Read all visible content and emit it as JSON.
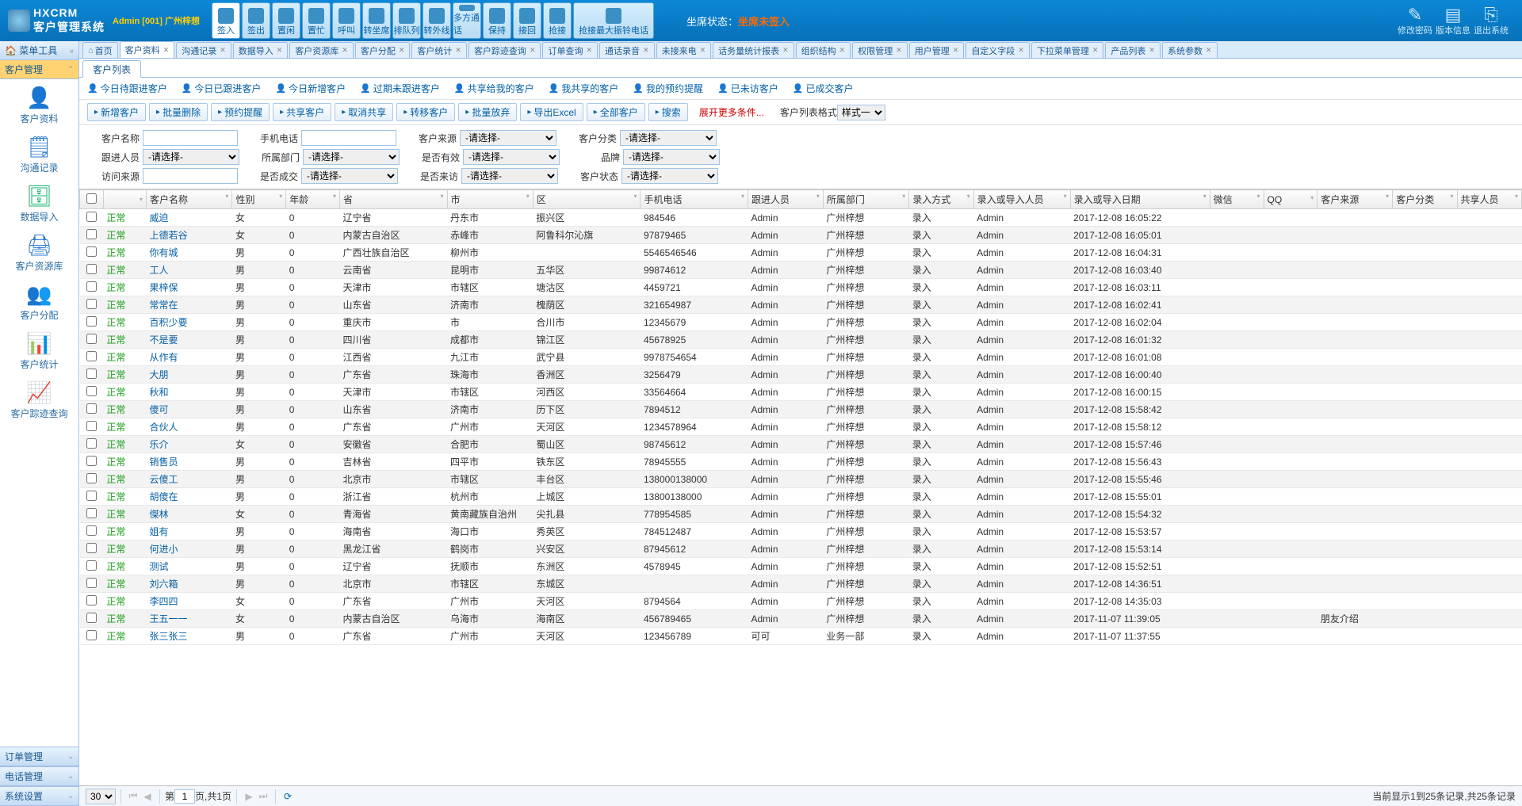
{
  "header": {
    "product_code": "HXCRM",
    "product_name": "客户管理系统",
    "user_line": "Admin [001] 广州梓想",
    "agent_status_label": "坐席状态：",
    "agent_status_value": "坐席未签入"
  },
  "big_toolbar": [
    {
      "key": "signin",
      "label": "签入",
      "active": true
    },
    {
      "key": "signout",
      "label": "签出"
    },
    {
      "key": "idle",
      "label": "置闲"
    },
    {
      "key": "busy",
      "label": "置忙"
    },
    {
      "key": "call",
      "label": "呼叫"
    },
    {
      "key": "xferagent",
      "label": "转坐席"
    },
    {
      "key": "queue",
      "label": "排队列"
    },
    {
      "key": "xferext",
      "label": "转外线"
    },
    {
      "key": "conf",
      "label": "多方通话"
    },
    {
      "key": "hold",
      "label": "保持"
    },
    {
      "key": "pickup",
      "label": "接回"
    },
    {
      "key": "grab",
      "label": "抢接"
    },
    {
      "key": "maxbell",
      "label": "抢接最大振铃电话",
      "wide": true
    }
  ],
  "top_right": [
    {
      "key": "chgpwd",
      "label": "修改密码",
      "icon": "✎"
    },
    {
      "key": "verinfo",
      "label": "版本信息",
      "icon": "▤"
    },
    {
      "key": "logout",
      "label": "退出系统",
      "icon": "⎘"
    }
  ],
  "left": {
    "header0": "菜单工具",
    "header_active": "客户管理",
    "nav": [
      {
        "key": "cust",
        "label": "客户资料",
        "icon": "👤",
        "color": "#2a7bd1"
      },
      {
        "key": "comm",
        "label": "沟通记录",
        "icon": "🗒",
        "color": "#2a7bd1"
      },
      {
        "key": "import",
        "label": "数据导入",
        "icon": "🗄",
        "color": "#19b36b"
      },
      {
        "key": "pool",
        "label": "客户资源库",
        "icon": "🖨",
        "color": "#2a7bd1"
      },
      {
        "key": "assign",
        "label": "客户分配",
        "icon": "👥",
        "color": "#e67e22"
      },
      {
        "key": "stats",
        "label": "客户统计",
        "icon": "📊",
        "color": "#c33"
      },
      {
        "key": "trace",
        "label": "客户踪迹查询",
        "icon": "📈",
        "color": "#e67e22"
      }
    ],
    "bottom": [
      {
        "key": "order",
        "label": "订单管理"
      },
      {
        "key": "phone",
        "label": "电话管理"
      },
      {
        "key": "sys",
        "label": "系统设置"
      }
    ]
  },
  "tabs": [
    {
      "key": "home",
      "label": "首页",
      "closable": false,
      "home": true
    },
    {
      "key": "cust",
      "label": "客户资料",
      "active": true
    },
    {
      "key": "comm",
      "label": "沟通记录"
    },
    {
      "key": "import",
      "label": "数据导入"
    },
    {
      "key": "pool",
      "label": "客户资源库"
    },
    {
      "key": "assign",
      "label": "客户分配"
    },
    {
      "key": "stats",
      "label": "客户统计"
    },
    {
      "key": "trace",
      "label": "客户踪迹查询"
    },
    {
      "key": "orderq",
      "label": "订单查询"
    },
    {
      "key": "rec",
      "label": "通话录音"
    },
    {
      "key": "miss",
      "label": "未接来电"
    },
    {
      "key": "traffic",
      "label": "话务量统计报表"
    },
    {
      "key": "org",
      "label": "组织结构"
    },
    {
      "key": "perm",
      "label": "权限管理"
    },
    {
      "key": "user",
      "label": "用户管理"
    },
    {
      "key": "field",
      "label": "自定义字段"
    },
    {
      "key": "dropdown",
      "label": "下拉菜单管理"
    },
    {
      "key": "prod",
      "label": "产品列表"
    },
    {
      "key": "sysparam",
      "label": "系统参数"
    }
  ],
  "subtab": {
    "label": "客户列表"
  },
  "action_links": [
    "今日待跟进客户",
    "今日已跟进客户",
    "今日新增客户",
    "过期未跟进客户",
    "共享给我的客户",
    "我共享的客户",
    "我的预约提醒",
    "已未访客户",
    "已成交客户"
  ],
  "buttons": [
    "新增客户",
    "批量删除",
    "预约提醒",
    "共享客户",
    "取消共享",
    "转移客户",
    "批量放弃",
    "导出Excel",
    "全部客户",
    "搜索"
  ],
  "expand_label": "展开更多条件...",
  "style_label": "客户列表格式",
  "style_value": "样式一",
  "filter": {
    "labels": {
      "name": "客户名称",
      "phone": "手机电话",
      "source": "客户来源",
      "cat": "客户分类",
      "follower": "跟进人员",
      "dept": "所属部门",
      "valid": "是否有效",
      "brand": "品牌",
      "visitsrc": "访问来源",
      "deal": "是否成交",
      "visited": "是否来访",
      "state": "客户状态"
    },
    "select_ph": "-请选择-"
  },
  "grid": {
    "columns": [
      "",
      "",
      "客户名称",
      "性别",
      "年龄",
      "省",
      "市",
      "区",
      "手机电话",
      "跟进人员",
      "所属部门",
      "录入方式",
      "录入或导入人员",
      "录入或导入日期",
      "微信",
      "QQ",
      "客户来源",
      "客户分类",
      "共享人员"
    ],
    "status_text": "正常",
    "rows": [
      {
        "name": "威迫",
        "sex": "女",
        "age": "0",
        "prov": "辽宁省",
        "city": "丹东市",
        "dist": "振兴区",
        "phone": "984546",
        "fol": "Admin",
        "dept": "广州梓想",
        "in": "录入",
        "by": "Admin",
        "dt": "2017-12-08 16:05:22",
        "src": ""
      },
      {
        "name": "上德若谷",
        "sex": "女",
        "age": "0",
        "prov": "内蒙古自治区",
        "city": "赤峰市",
        "dist": "阿鲁科尔沁旗",
        "phone": "97879465",
        "fol": "Admin",
        "dept": "广州梓想",
        "in": "录入",
        "by": "Admin",
        "dt": "2017-12-08 16:05:01",
        "src": ""
      },
      {
        "name": "你有城",
        "sex": "男",
        "age": "0",
        "prov": "广西壮族自治区",
        "city": "柳州市",
        "dist": "",
        "phone": "5546546546",
        "fol": "Admin",
        "dept": "广州梓想",
        "in": "录入",
        "by": "Admin",
        "dt": "2017-12-08 16:04:31",
        "src": ""
      },
      {
        "name": "工人",
        "sex": "男",
        "age": "0",
        "prov": "云南省",
        "city": "昆明市",
        "dist": "五华区",
        "phone": "99874612",
        "fol": "Admin",
        "dept": "广州梓想",
        "in": "录入",
        "by": "Admin",
        "dt": "2017-12-08 16:03:40",
        "src": ""
      },
      {
        "name": "果梓保",
        "sex": "男",
        "age": "0",
        "prov": "天津市",
        "city": "市辖区",
        "dist": "塘沽区",
        "phone": "4459721",
        "fol": "Admin",
        "dept": "广州梓想",
        "in": "录入",
        "by": "Admin",
        "dt": "2017-12-08 16:03:11",
        "src": ""
      },
      {
        "name": "常常在",
        "sex": "男",
        "age": "0",
        "prov": "山东省",
        "city": "济南市",
        "dist": "槐荫区",
        "phone": "321654987",
        "fol": "Admin",
        "dept": "广州梓想",
        "in": "录入",
        "by": "Admin",
        "dt": "2017-12-08 16:02:41",
        "src": ""
      },
      {
        "name": "百积少要",
        "sex": "男",
        "age": "0",
        "prov": "重庆市",
        "city": "市",
        "dist": "合川市",
        "phone": "12345679",
        "fol": "Admin",
        "dept": "广州梓想",
        "in": "录入",
        "by": "Admin",
        "dt": "2017-12-08 16:02:04",
        "src": ""
      },
      {
        "name": "不是要",
        "sex": "男",
        "age": "0",
        "prov": "四川省",
        "city": "成都市",
        "dist": "锦江区",
        "phone": "45678925",
        "fol": "Admin",
        "dept": "广州梓想",
        "in": "录入",
        "by": "Admin",
        "dt": "2017-12-08 16:01:32",
        "src": ""
      },
      {
        "name": "从作有",
        "sex": "男",
        "age": "0",
        "prov": "江西省",
        "city": "九江市",
        "dist": "武宁县",
        "phone": "9978754654",
        "fol": "Admin",
        "dept": "广州梓想",
        "in": "录入",
        "by": "Admin",
        "dt": "2017-12-08 16:01:08",
        "src": ""
      },
      {
        "name": "大朋",
        "sex": "男",
        "age": "0",
        "prov": "广东省",
        "city": "珠海市",
        "dist": "香洲区",
        "phone": "3256479",
        "fol": "Admin",
        "dept": "广州梓想",
        "in": "录入",
        "by": "Admin",
        "dt": "2017-12-08 16:00:40",
        "src": ""
      },
      {
        "name": "秋和",
        "sex": "男",
        "age": "0",
        "prov": "天津市",
        "city": "市辖区",
        "dist": "河西区",
        "phone": "33564664",
        "fol": "Admin",
        "dept": "广州梓想",
        "in": "录入",
        "by": "Admin",
        "dt": "2017-12-08 16:00:15",
        "src": ""
      },
      {
        "name": "傻可",
        "sex": "男",
        "age": "0",
        "prov": "山东省",
        "city": "济南市",
        "dist": "历下区",
        "phone": "7894512",
        "fol": "Admin",
        "dept": "广州梓想",
        "in": "录入",
        "by": "Admin",
        "dt": "2017-12-08 15:58:42",
        "src": ""
      },
      {
        "name": "合伙人",
        "sex": "男",
        "age": "0",
        "prov": "广东省",
        "city": "广州市",
        "dist": "天河区",
        "phone": "1234578964",
        "fol": "Admin",
        "dept": "广州梓想",
        "in": "录入",
        "by": "Admin",
        "dt": "2017-12-08 15:58:12",
        "src": ""
      },
      {
        "name": "乐介",
        "sex": "女",
        "age": "0",
        "prov": "安徽省",
        "city": "合肥市",
        "dist": "蜀山区",
        "phone": "98745612",
        "fol": "Admin",
        "dept": "广州梓想",
        "in": "录入",
        "by": "Admin",
        "dt": "2017-12-08 15:57:46",
        "src": ""
      },
      {
        "name": "销售员",
        "sex": "男",
        "age": "0",
        "prov": "吉林省",
        "city": "四平市",
        "dist": "铁东区",
        "phone": "78945555",
        "fol": "Admin",
        "dept": "广州梓想",
        "in": "录入",
        "by": "Admin",
        "dt": "2017-12-08 15:56:43",
        "src": ""
      },
      {
        "name": "云傻工",
        "sex": "男",
        "age": "0",
        "prov": "北京市",
        "city": "市辖区",
        "dist": "丰台区",
        "phone": "138000138000",
        "fol": "Admin",
        "dept": "广州梓想",
        "in": "录入",
        "by": "Admin",
        "dt": "2017-12-08 15:55:46",
        "src": ""
      },
      {
        "name": "胡傻在",
        "sex": "男",
        "age": "0",
        "prov": "浙江省",
        "city": "杭州市",
        "dist": "上城区",
        "phone": "13800138000",
        "fol": "Admin",
        "dept": "广州梓想",
        "in": "录入",
        "by": "Admin",
        "dt": "2017-12-08 15:55:01",
        "src": ""
      },
      {
        "name": "傑林",
        "sex": "女",
        "age": "0",
        "prov": "青海省",
        "city": "黄南藏族自治州",
        "dist": "尖扎县",
        "phone": "778954585",
        "fol": "Admin",
        "dept": "广州梓想",
        "in": "录入",
        "by": "Admin",
        "dt": "2017-12-08 15:54:32",
        "src": ""
      },
      {
        "name": "姐有",
        "sex": "男",
        "age": "0",
        "prov": "海南省",
        "city": "海口市",
        "dist": "秀英区",
        "phone": "784512487",
        "fol": "Admin",
        "dept": "广州梓想",
        "in": "录入",
        "by": "Admin",
        "dt": "2017-12-08 15:53:57",
        "src": ""
      },
      {
        "name": "何进小",
        "sex": "男",
        "age": "0",
        "prov": "黑龙江省",
        "city": "鹤岗市",
        "dist": "兴安区",
        "phone": "87945612",
        "fol": "Admin",
        "dept": "广州梓想",
        "in": "录入",
        "by": "Admin",
        "dt": "2017-12-08 15:53:14",
        "src": ""
      },
      {
        "name": "测试",
        "sex": "男",
        "age": "0",
        "prov": "辽宁省",
        "city": "抚顺市",
        "dist": "东洲区",
        "phone": "4578945",
        "fol": "Admin",
        "dept": "广州梓想",
        "in": "录入",
        "by": "Admin",
        "dt": "2017-12-08 15:52:51",
        "src": ""
      },
      {
        "name": "刘六箱",
        "sex": "男",
        "age": "0",
        "prov": "北京市",
        "city": "市辖区",
        "dist": "东城区",
        "phone": "",
        "fol": "Admin",
        "dept": "广州梓想",
        "in": "录入",
        "by": "Admin",
        "dt": "2017-12-08 14:36:51",
        "src": ""
      },
      {
        "name": "李四四",
        "sex": "女",
        "age": "0",
        "prov": "广东省",
        "city": "广州市",
        "dist": "天河区",
        "phone": "8794564",
        "fol": "Admin",
        "dept": "广州梓想",
        "in": "录入",
        "by": "Admin",
        "dt": "2017-12-08 14:35:03",
        "src": ""
      },
      {
        "name": "王五一一",
        "sex": "女",
        "age": "0",
        "prov": "内蒙古自治区",
        "city": "乌海市",
        "dist": "海南区",
        "phone": "456789465",
        "fol": "Admin",
        "dept": "广州梓想",
        "in": "录入",
        "by": "Admin",
        "dt": "2017-11-07 11:39:05",
        "src": "朋友介绍"
      },
      {
        "name": "张三张三",
        "sex": "男",
        "age": "0",
        "prov": "广东省",
        "city": "广州市",
        "dist": "天河区",
        "phone": "123456789",
        "fol": "可可",
        "dept": "业务一部",
        "in": "录入",
        "by": "Admin",
        "dt": "2017-11-07 11:37:55",
        "src": ""
      }
    ]
  },
  "pager": {
    "page_size": "30",
    "page": "1",
    "page_label_1": "第",
    "page_label_2": "页,共1页",
    "info": "当前显示1到25条记录,共25条记录"
  }
}
